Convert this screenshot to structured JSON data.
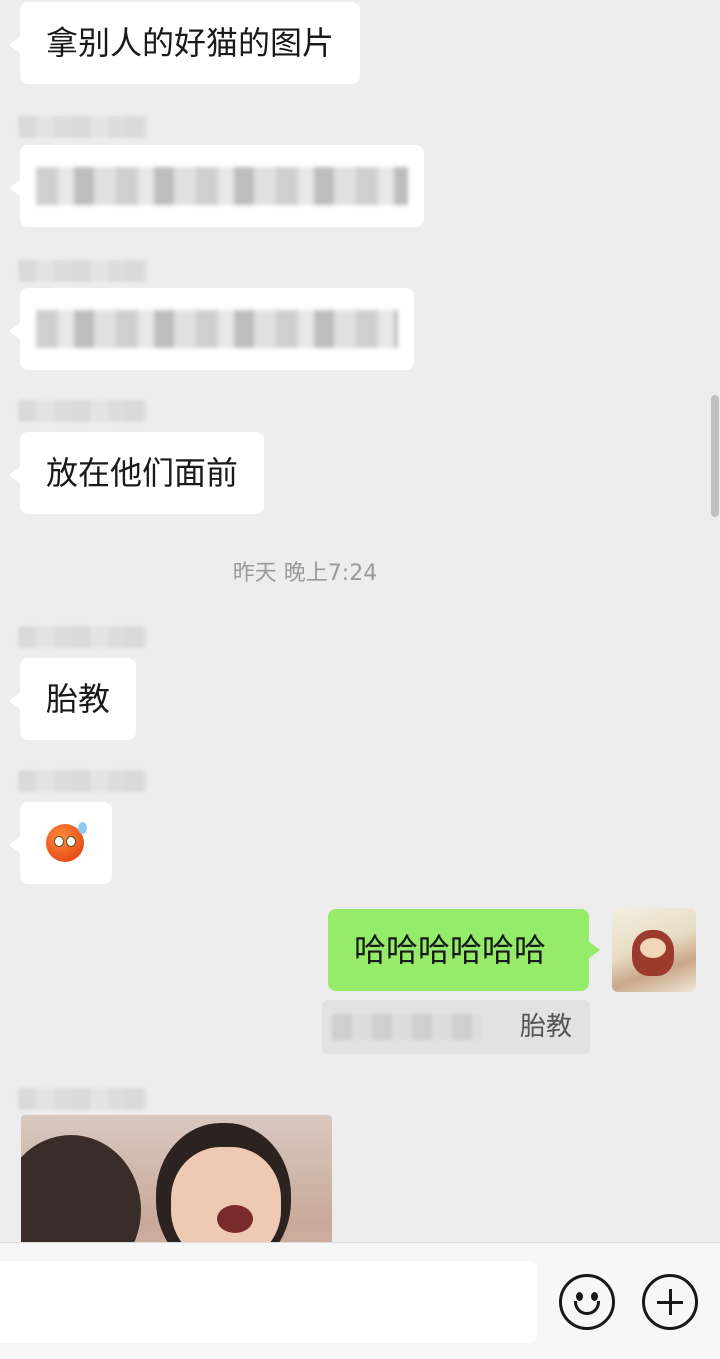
{
  "messages": [
    {
      "text": "拿别人的好猫的图片"
    },
    {
      "text": "放在他们面前"
    },
    {
      "text": "胎教"
    },
    {
      "text": "哈哈哈哈哈哈"
    }
  ],
  "timestamp": "昨天 晚上7:24",
  "emoji": {
    "icon": "sweat-frown-emoji-icon"
  },
  "quote": {
    "text": "胎教"
  },
  "input": {
    "placeholder": ""
  },
  "icons": {
    "emoji_button": "smile-icon",
    "more_button": "plus-circle-icon"
  },
  "colors": {
    "background": "#ededed",
    "sent_bubble": "#95ec69",
    "received_bubble": "#ffffff"
  }
}
